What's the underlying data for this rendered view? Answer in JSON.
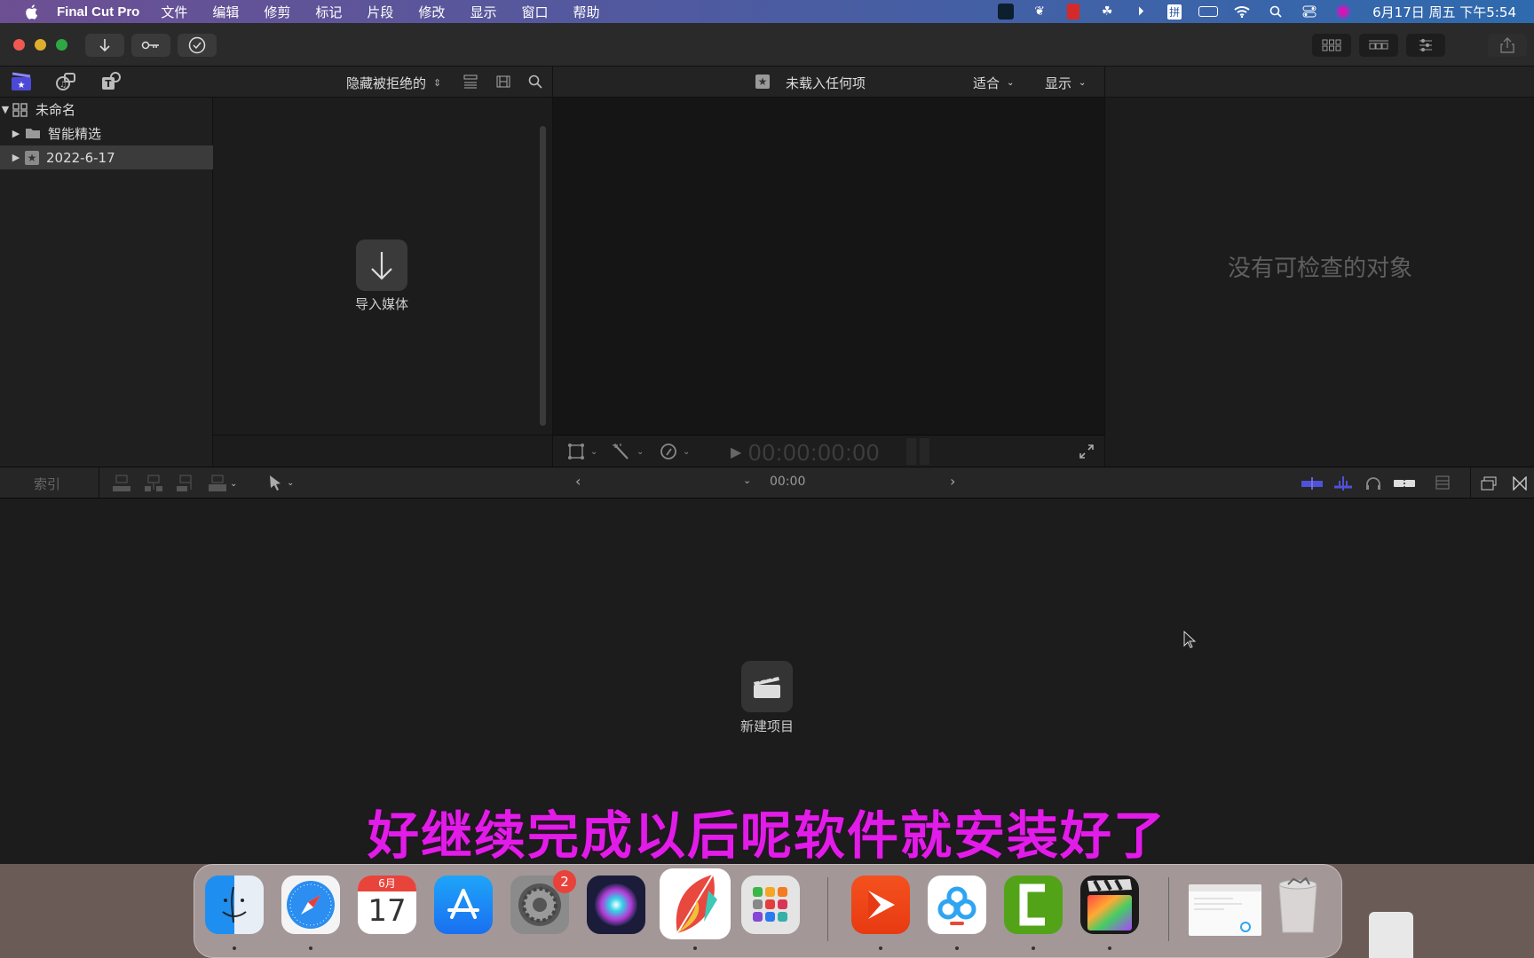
{
  "menubar": {
    "app_name": "Final Cut Pro",
    "items": [
      "文件",
      "编辑",
      "修剪",
      "标记",
      "片段",
      "修改",
      "显示",
      "窗口",
      "帮助"
    ],
    "clock": "6月17日 周五 下午5:54",
    "status_icons": [
      "app-icon-dark",
      "leaf-icon",
      "red-app-icon",
      "baidu-cloud-icon",
      "play-circle-icon",
      "pinyin-input-icon",
      "battery-charging-icon",
      "wifi-icon",
      "spotlight-search-icon",
      "control-center-icon",
      "siri-icon"
    ],
    "input_method_label": "拼"
  },
  "titlebar": {
    "left_buttons": [
      "import-icon",
      "keyword-icon",
      "checkmark-icon"
    ],
    "right_buttons": [
      "browser-layout-icon",
      "timeline-layout-icon",
      "inspector-layout-icon",
      "share-icon"
    ]
  },
  "browser_bar": {
    "tabs": [
      "libraries-icon",
      "photos-audio-icon",
      "titles-generators-icon"
    ],
    "filter_label": "隐藏被拒绝的"
  },
  "sidebar": {
    "library": "未命名",
    "items": [
      {
        "label": "智能精选",
        "icon": "folder-icon"
      },
      {
        "label": "2022-6-17",
        "icon": "event-star-icon",
        "selected": true
      }
    ]
  },
  "browser": {
    "import_label": "导入媒体"
  },
  "viewer_bar": {
    "title": "未载入任何项",
    "zoom_label": "适合",
    "view_label": "显示"
  },
  "viewer_foot": {
    "timecode": "00:00:00:00"
  },
  "inspector": {
    "empty_text": "没有可检查的对象"
  },
  "timeline_bar": {
    "index_label": "索引",
    "timecode": "00:00"
  },
  "timeline": {
    "new_project_label": "新建项目"
  },
  "subtitle": "好继续完成以后呢软件就安装好了",
  "dock": {
    "apps": [
      {
        "name": "Finder",
        "icon": "finder-icon"
      },
      {
        "name": "Safari",
        "icon": "safari-icon"
      },
      {
        "name": "Calendar",
        "icon": "calendar-icon",
        "month": "6月",
        "day": "17"
      },
      {
        "name": "App Store",
        "icon": "app-store-icon"
      },
      {
        "name": "System Preferences",
        "icon": "system-preferences-icon",
        "badge": "2"
      },
      {
        "name": "Siri",
        "icon": "siri-icon"
      },
      {
        "name": "Notes App",
        "icon": "colorful-leaf-icon"
      },
      {
        "name": "Launchpad",
        "icon": "launchpad-icon"
      },
      {
        "name": "Media Player",
        "icon": "red-play-icon"
      },
      {
        "name": "Baidu Netdisk",
        "icon": "baidu-netdisk-icon"
      },
      {
        "name": "Camtasia",
        "icon": "camtasia-icon"
      },
      {
        "name": "Final Cut Pro",
        "icon": "final-cut-pro-icon"
      },
      {
        "name": "Document Window",
        "icon": "document-thumbnail-icon"
      },
      {
        "name": "Trash",
        "icon": "trash-icon"
      }
    ]
  }
}
